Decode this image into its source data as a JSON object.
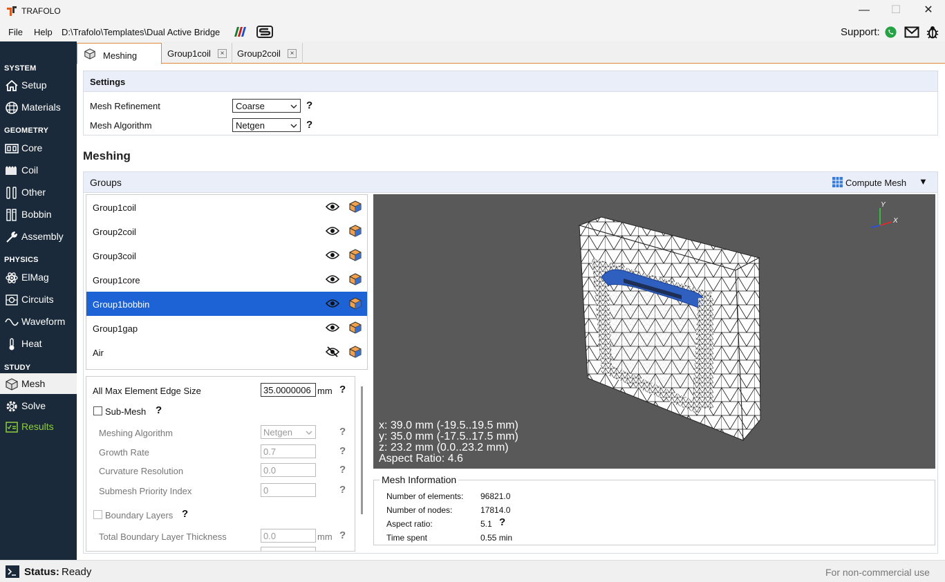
{
  "window": {
    "title": "TRAFOLO",
    "minimize": "—",
    "maximize": "☐",
    "close": "✕"
  },
  "menu": {
    "file": "File",
    "help": "Help",
    "path": "D:\\Trafolo\\Templates\\Dual Active Bridge",
    "support_label": "Support:"
  },
  "sidebar": {
    "system": "SYSTEM",
    "setup": "Setup",
    "materials": "Materials",
    "geometry": "GEOMETRY",
    "core": "Core",
    "coil": "Coil",
    "other": "Other",
    "bobbin": "Bobbin",
    "assembly": "Assembly",
    "physics": "PHYSICS",
    "elmag": "ElMag",
    "circuits": "Circuits",
    "waveform": "Waveform",
    "heat": "Heat",
    "study": "STUDY",
    "mesh": "Mesh",
    "solve": "Solve",
    "results": "Results"
  },
  "tabs": {
    "meshing": "Meshing",
    "group1coil": "Group1coil",
    "group2coil": "Group2coil",
    "close": "×"
  },
  "settings": {
    "title": "Settings",
    "mesh_refinement_label": "Mesh Refinement",
    "mesh_refinement_value": "Coarse",
    "mesh_algorithm_label": "Mesh Algorithm",
    "mesh_algorithm_value": "Netgen",
    "help": "?"
  },
  "meshing": {
    "heading": "Meshing",
    "groups_title": "Groups",
    "compute_mesh": "Compute Mesh",
    "dropdown": "▼"
  },
  "groups": [
    {
      "name": "Group1coil",
      "visible": true
    },
    {
      "name": "Group2coil",
      "visible": true
    },
    {
      "name": "Group3coil",
      "visible": true
    },
    {
      "name": "Group1core",
      "visible": true
    },
    {
      "name": "Group1bobbin",
      "visible": true
    },
    {
      "name": "Group1gap",
      "visible": true
    },
    {
      "name": "Air",
      "visible": false
    }
  ],
  "props": {
    "max_edge_label": "All Max Element Edge Size",
    "max_edge_value": "35.0000006",
    "unit_mm": "mm",
    "submesh_label": "Sub-Mesh",
    "meshing_algorithm_label": "Meshing Algorithm",
    "meshing_algorithm_value": "Netgen",
    "growth_rate_label": "Growth Rate",
    "growth_rate_value": "0.7",
    "curvature_label": "Curvature Resolution",
    "curvature_value": "0.0",
    "priority_label": "Submesh Priority Index",
    "priority_value": "0",
    "boundary_layers_label": "Boundary Layers",
    "total_bl_label": "Total Boundary Layer Thickness",
    "total_bl_value": "0.0",
    "help": "?"
  },
  "viewport": {
    "x_line": "x: 39.0 mm (-19.5..19.5 mm)",
    "y_line": "y: 35.0 mm (-17.5..17.5 mm)",
    "z_line": "z: 23.2 mm (0.0..23.2 mm)",
    "aspect_line": "Aspect Ratio: 4.6",
    "axis_x": "X",
    "axis_y": "Y"
  },
  "mesh_info": {
    "title": "Mesh Information",
    "elements_label": "Number of elements:",
    "elements_value": "96821.0",
    "nodes_label": "Number of nodes:",
    "nodes_value": "17814.0",
    "aspect_label": "Aspect ratio:",
    "aspect_value": "5.1",
    "time_label": "Time spent",
    "time_value": "0.55 min",
    "help": "?"
  },
  "status": {
    "label": "Status:",
    "value": "Ready",
    "license": "For non-commercial use"
  },
  "colors": {
    "accent": "#e08a3a",
    "sidebar_bg": "#1b2a3a",
    "selection": "#1e63d6",
    "results": "#8ccf3c",
    "mesh_blue": "#2f5fbf"
  }
}
